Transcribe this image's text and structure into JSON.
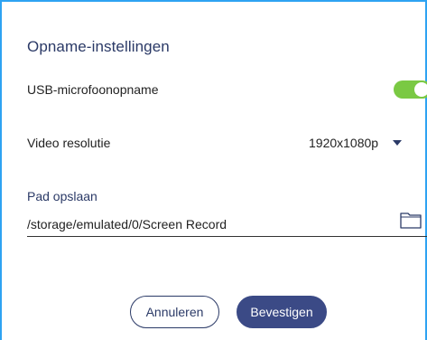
{
  "dialog": {
    "title": "Opname-instellingen"
  },
  "usb_microphone": {
    "label": "USB-microfoonopname",
    "enabled": true,
    "color": "#7ac943"
  },
  "video_resolution": {
    "label": "Video resolutie",
    "selected": "1920x1080p",
    "icon": "caret-down-icon"
  },
  "save_path": {
    "label": "Pad opslaan",
    "value": "/storage/emulated/0/Screen Record",
    "icon": "folder-icon"
  },
  "buttons": {
    "cancel_label": "Annuleren",
    "confirm_label": "Bevestigen"
  },
  "colors": {
    "accent": "#2b3a67",
    "confirm_bg": "#3b4a86",
    "frame_border": "#2ea3f2"
  }
}
